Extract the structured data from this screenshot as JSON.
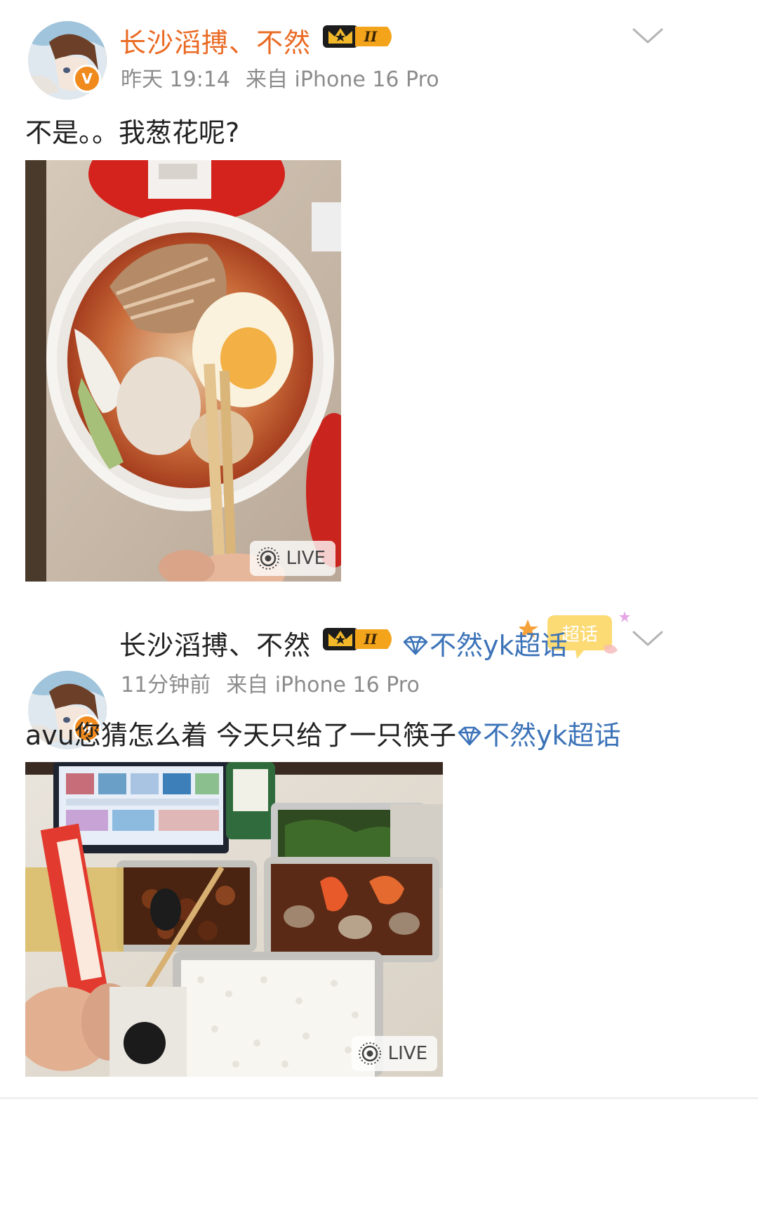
{
  "posts": [
    {
      "author": "长沙滔搏、不然",
      "level_badge": "II",
      "time": "昨天 19:14",
      "source": "来自 iPhone 16 Pro",
      "text": "不是。。我葱花呢?",
      "image_badge": "LIVE",
      "verified_mark": "V"
    },
    {
      "author": "长沙滔搏、不然",
      "level_badge": "II",
      "supertopic": "不然yk超话",
      "supertopic_tag": "超话",
      "time": "11分钟前",
      "source": "来自 iPhone 16 Pro",
      "text": "avu您猜怎么着 今天只给了一只筷子",
      "text_topic": "不然yk超话",
      "image_badge": "LIVE",
      "verified_mark": "V"
    }
  ],
  "colors": {
    "author_highlight": "#ea6a23",
    "link": "#3c73b8",
    "meta": "#8c8c8c",
    "badge_orange": "#f08a1c"
  },
  "icons": {
    "chevron": "chevron-down-icon",
    "crown": "crown-level-icon",
    "gem": "supertopic-gem-icon",
    "live": "live-photo-icon"
  }
}
